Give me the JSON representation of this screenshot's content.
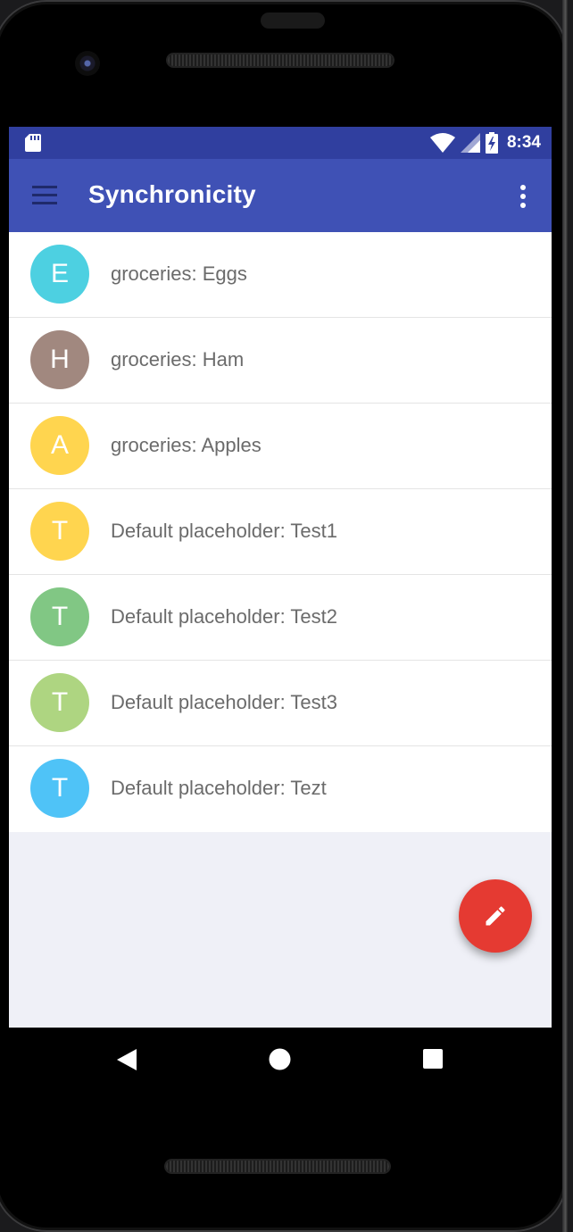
{
  "status_bar": {
    "time": "8:34",
    "icons": [
      "sd-card-icon",
      "wifi-icon",
      "signal-icon",
      "battery-charging-icon"
    ]
  },
  "app_bar": {
    "title": "Synchronicity",
    "icons": [
      "menu-icon",
      "overflow-menu-icon"
    ]
  },
  "list": {
    "items": [
      {
        "initial": "E",
        "text": "groceries: Eggs",
        "color": "#4dd0e1"
      },
      {
        "initial": "H",
        "text": "groceries: Ham",
        "color": "#a1887f"
      },
      {
        "initial": "A",
        "text": "groceries: Apples",
        "color": "#ffd54f"
      },
      {
        "initial": "T",
        "text": "Default placeholder: Test1",
        "color": "#ffd54f"
      },
      {
        "initial": "T",
        "text": "Default placeholder: Test2",
        "color": "#81c784"
      },
      {
        "initial": "T",
        "text": "Default placeholder: Test3",
        "color": "#aed581"
      },
      {
        "initial": "T",
        "text": "Default placeholder: Tezt",
        "color": "#4fc3f7"
      }
    ]
  },
  "fab": {
    "icon": "pencil-icon",
    "color": "#e53a32"
  },
  "nav_bar": {
    "icons": [
      "back-icon",
      "home-icon",
      "recents-icon"
    ]
  },
  "colors": {
    "primary": "#3f51b5",
    "primary_dark": "#303f9f",
    "background": "#eff0f7"
  }
}
